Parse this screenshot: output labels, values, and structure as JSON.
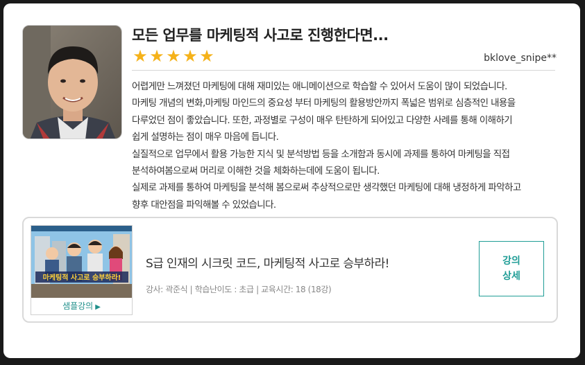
{
  "review": {
    "title": "모든 업무를 마케팅적 사고로 진행한다면...",
    "rating": 5,
    "stars": [
      "★",
      "★",
      "★",
      "★",
      "★"
    ],
    "author": "bklove_snipe**",
    "body_lines": [
      "어렵게만 느껴졌던 마케팅에 대해 재미있는 애니메이션으로 학습할 수 있어서 도움이 많이 되었습니다.",
      "마케팅 개념의 변화,마케팅 마인드의 중요성 부터 마케팅의 활용방안까지 폭넓은 범위로 심층적인 내용을",
      "다루었던 점이 좋았습니다. 또한, 과정별로 구성이 매우 탄탄하게 되어있고 다양한 사례를 통해 이해하기",
      "쉽게 설명하는 점이 매우 마음에 듭니다.",
      "실질적으로 업무에서 활용 가능한 지식 및 분석방법 등을 소개함과 동시에 과제를 통하여 마케팅을 직접",
      "분석하여봄으로써 머리로 이해한 것을 체화하는데에 도움이 됩니다.",
      "실제로 과제를 통하여 마케팅을 분석해 봄으로써 추상적으로만 생각했던 마케팅에 대해 냉정하게 파악하고",
      "향후 대안점을 파익해볼 수 있었습니다."
    ]
  },
  "course": {
    "thumbnail_caption": "마케팅적 사고로 승부하라!",
    "sample_label": "샘플강의",
    "sample_arrow": "▶",
    "title": "S급 인재의 시크릿 코드, 마케팅적 사고로 승부하라!",
    "meta": "강사: 곽준식 | 학습난이도 : 초급 | 교육시간: 18 (18강)",
    "detail_button_line1": "강의",
    "detail_button_line2": "상세"
  },
  "colors": {
    "star": "#f5b21a",
    "accent": "#1f9d96",
    "background": "#1a1a1a"
  }
}
